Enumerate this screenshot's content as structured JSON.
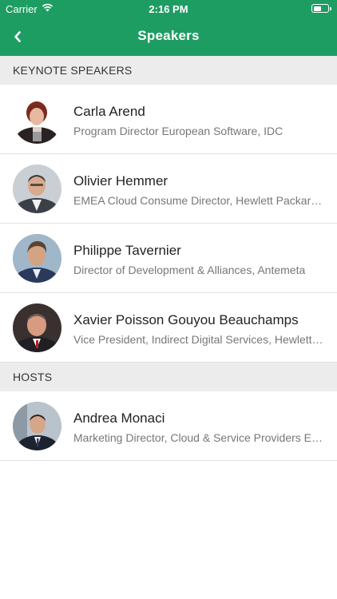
{
  "status_bar": {
    "carrier": "Carrier",
    "time": "2:16 PM"
  },
  "nav": {
    "title": "Speakers",
    "back_icon": "chevron-left-icon"
  },
  "colors": {
    "accent": "#1e9d63",
    "section_bg": "#ececec"
  },
  "sections": [
    {
      "header": "KEYNOTE SPEAKERS",
      "speakers": [
        {
          "name": "Carla Arend",
          "title": "Program Director European Software, IDC"
        },
        {
          "name": "Olivier Hemmer",
          "title": "EMEA Cloud Consume Director, Hewlett Packard Enterprise"
        },
        {
          "name": "Philippe Tavernier",
          "title": "Director of Development & Alliances, Antemeta"
        },
        {
          "name": "Xavier Poisson Gouyou Beauchamps",
          "title": "Vice President, Indirect Digital Services, Hewlett Packard Enterprise"
        }
      ]
    },
    {
      "header": "HOSTS",
      "speakers": [
        {
          "name": "Andrea Monaci",
          "title": "Marketing Director, Cloud & Service Providers EMEA"
        }
      ]
    }
  ]
}
